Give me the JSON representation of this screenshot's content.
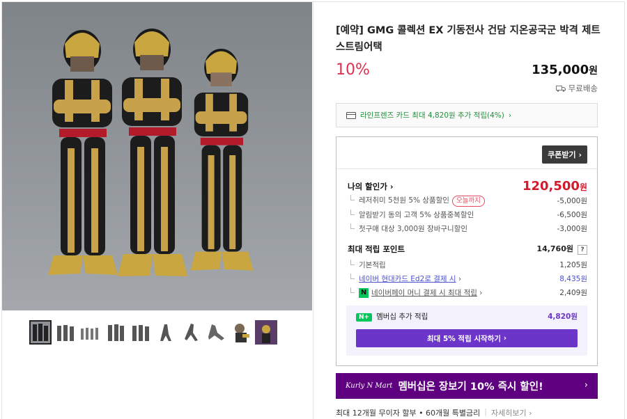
{
  "product": {
    "title": "[예약] GMG 콜렉션 EX 기동전사 건담 지온공국군 박격 제트스트림어택",
    "discount_rate": "10%",
    "price": "135,000",
    "price_unit": "원",
    "shipping": "무료배송"
  },
  "card_promo": {
    "text": "라인프렌즈 카드 최대 4,820원 추가 적립(4%)"
  },
  "benefits": {
    "coupon_button": "쿠폰받기",
    "my_price_label": "나의 할인가",
    "my_price": "120,500",
    "my_price_unit": "원",
    "discounts": [
      {
        "label": "레저취미 5천원 5% 상품할인",
        "tag": "오늘까지",
        "value": "-5,000원"
      },
      {
        "label": "알림받기 동의 고객 5% 상품중복할인",
        "value": "-6,500원"
      },
      {
        "label": "첫구매 대상 3,000원 장바구니할인",
        "value": "-3,000원"
      }
    ],
    "points_label": "최대 적립 포인트",
    "points_total": "14,760원",
    "points_help": "?",
    "points": [
      {
        "label": "기본적립",
        "value": "1,205원"
      },
      {
        "label": "네이버 현대카드 Ed2로 결제 시",
        "value": "8,435원"
      },
      {
        "label": "네이버페이 머니 결제 시 최대 적립",
        "value": "2,409원"
      }
    ],
    "membership": {
      "badge": "N+",
      "label": "멤버십 추가 적립",
      "value": "4,820원",
      "button": "최대 5% 적립 시작하기"
    }
  },
  "banner": {
    "logo": "Kurly N Mart",
    "text": "멤버십은 장보기 10% 즉시 할인!"
  },
  "installment": {
    "text": "최대 12개월 무이자 할부 • 60개월 특별금리",
    "more": "자세히보기"
  },
  "gallery": {
    "thumbnail_count": 10
  }
}
